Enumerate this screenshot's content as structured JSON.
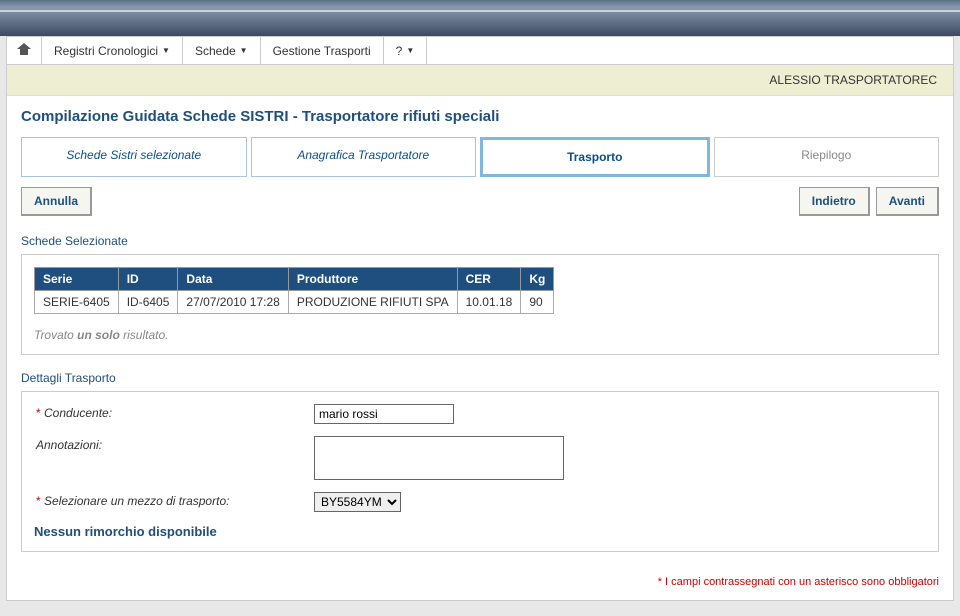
{
  "menu": {
    "item1": "Registri Cronologici",
    "item2": "Schede",
    "item3": "Gestione Trasporti",
    "item4": "?"
  },
  "user": "ALESSIO TRASPORTATOREC",
  "pageTitle": "Compilazione Guidata Schede SISTRI - Trasportatore rifiuti speciali",
  "steps": {
    "s1": "Schede Sistri selezionate",
    "s2": "Anagrafica Trasportatore",
    "s3": "Trasporto",
    "s4": "Riepilogo"
  },
  "buttons": {
    "annulla": "Annulla",
    "indietro": "Indietro",
    "avanti": "Avanti"
  },
  "sectionSchede": "Schede Selezionate",
  "table": {
    "headers": {
      "serie": "Serie",
      "id": "ID",
      "data": "Data",
      "produttore": "Produttore",
      "cer": "CER",
      "kg": "Kg"
    },
    "row": {
      "serie": "SERIE-6405",
      "id": "ID-6405",
      "data": "27/07/2010 17:28",
      "produttore": "PRODUZIONE RIFIUTI SPA",
      "cer": "10.01.18",
      "kg": "90"
    }
  },
  "resultNote": {
    "prefix": "Trovato ",
    "bold": "un solo",
    "suffix": " risultato."
  },
  "sectionDettagli": "Dettagli Trasporto",
  "form": {
    "conducenteLabel": "Conducente:",
    "conducenteValue": "mario rossi",
    "annotazioniLabel": "Annotazioni:",
    "annotazioniValue": "",
    "mezzoLabel": "Selezionare un mezzo di trasporto:",
    "mezzoValue": "BY5584YM"
  },
  "noTrailer": "Nessun rimorchio disponibile",
  "mandatoryNote": "* I campi contrassegnati con un asterisco sono obbligatori"
}
